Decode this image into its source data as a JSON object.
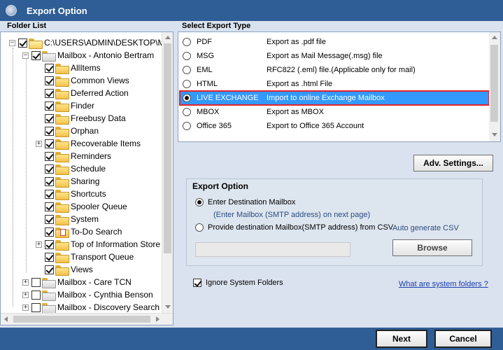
{
  "window": {
    "title": "Export Option"
  },
  "left_panel": {
    "label": "Folder List",
    "root_path": "C:\\USERS\\ADMIN\\DESKTOP\\MA",
    "mailbox_name": "Mailbox - Antonio Bertram",
    "folders": [
      "AllItems",
      "Common Views",
      "Deferred Action",
      "Finder",
      "Freebusy Data",
      "Orphan",
      "Recoverable Items",
      "Reminders",
      "Schedule",
      "Sharing",
      "Shortcuts",
      "Spooler Queue",
      "System",
      "To-Do Search",
      "Top of Information Store",
      "Transport Queue",
      "Views"
    ],
    "other_mailboxes": [
      "Mailbox - Care TCN",
      "Mailbox - Cynthia Benson",
      "Mailbox - Discovery Search M"
    ]
  },
  "right_panel": {
    "label": "Select Export Type",
    "types": [
      {
        "type": "PDF",
        "desc": "Export as .pdf file"
      },
      {
        "type": "MSG",
        "desc": "Export as Mail Message(.msg) file"
      },
      {
        "type": "EML",
        "desc": "RFC822 (.eml) file.(Applicable only for mail)"
      },
      {
        "type": "HTML",
        "desc": "Export as .html File"
      },
      {
        "type": "LIVE EXCHANGE",
        "desc": "Import to online Exchange Mailbox"
      },
      {
        "type": "MBOX",
        "desc": "Export as MBOX"
      },
      {
        "type": "Office 365",
        "desc": "Export to Office 365 Account"
      }
    ],
    "selected": "LIVE EXCHANGE"
  },
  "adv_settings_label": "Adv. Settings...",
  "export_option": {
    "legend": "Export Option",
    "opt1": "Enter Destination Mailbox",
    "opt1_hint": "(Enter Mailbox (SMTP address) on next page)",
    "opt2": "Provide destination Mailbox(SMTP address) from CSV",
    "auto_generate": "Auto generate CSV",
    "browse_label": "Browse"
  },
  "ignore_label": "Ignore System Folders",
  "system_folders_link": "What are system folders ?",
  "next_label": "Next",
  "cancel_label": "Cancel",
  "colors": {
    "title_bar": "#2f5d95",
    "selection": "#3399ff",
    "highlight_border": "#e8202a"
  }
}
